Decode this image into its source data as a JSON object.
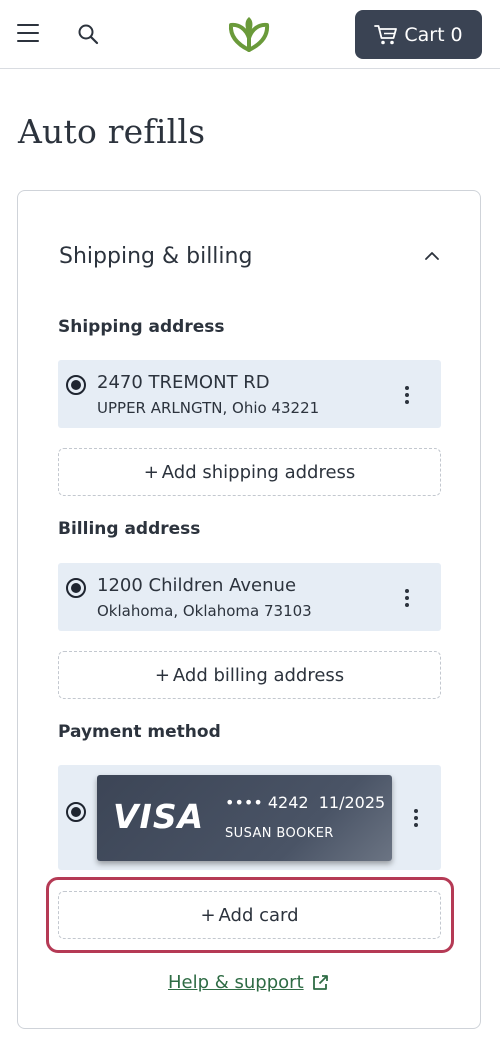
{
  "header": {
    "menu_icon": "hamburger-menu-icon",
    "search_icon": "search-icon",
    "logo_icon": "leaf-heart-logo",
    "cart": {
      "label": "Cart",
      "count": "0",
      "icon": "cart-icon"
    }
  },
  "page": {
    "title": "Auto refills"
  },
  "panel": {
    "section_title": "Shipping & billing",
    "shipping": {
      "label": "Shipping address",
      "selected": {
        "line1": "2470 TREMONT RD",
        "line2": "UPPER ARLNGTN, Ohio 43221"
      },
      "add_label": "Add shipping address"
    },
    "billing": {
      "label": "Billing address",
      "selected": {
        "line1": "1200 Children Avenue",
        "line2": "Oklahoma, Oklahoma 73103"
      },
      "add_label": "Add billing address"
    },
    "payment": {
      "label": "Payment method",
      "card": {
        "brand": "VISA",
        "number": "•••• 4242",
        "expiry": "11/2025",
        "holder": "SUSAN BOOKER"
      },
      "add_label": "Add card"
    },
    "help_label": "Help & support"
  },
  "colors": {
    "accent": "#3a4353",
    "option_bg": "#e6edf5",
    "highlight": "#b53a55",
    "link": "#2f6c45",
    "logo": "#6a9a3a"
  }
}
